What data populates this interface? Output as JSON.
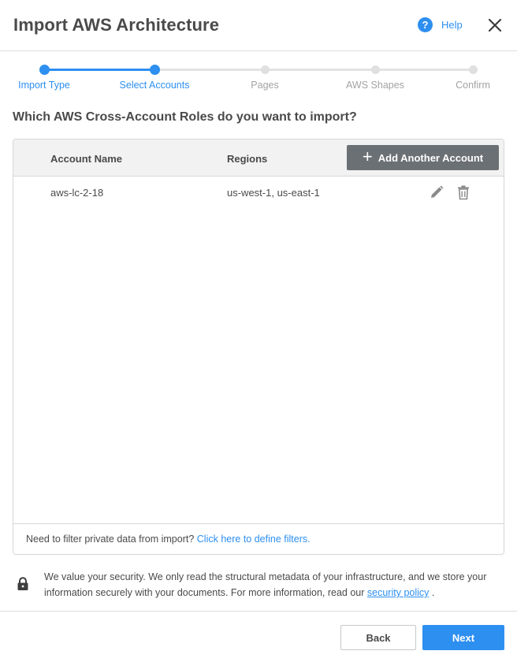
{
  "header": {
    "title": "Import AWS Architecture",
    "help_label": "Help",
    "help_icon": "question-circle-icon",
    "close_icon": "close-icon"
  },
  "stepper": {
    "steps": [
      {
        "label": "Import Type",
        "state": "complete"
      },
      {
        "label": "Select Accounts",
        "state": "current"
      },
      {
        "label": "Pages",
        "state": "pending"
      },
      {
        "label": "AWS Shapes",
        "state": "pending"
      },
      {
        "label": "Confirm",
        "state": "pending"
      }
    ]
  },
  "question": "Which AWS Cross-Account Roles do you want to import?",
  "table": {
    "columns": [
      "Account Name",
      "Regions"
    ],
    "add_button_label": "Add Another Account",
    "rows": [
      {
        "account_name": "aws-lc-2-18",
        "regions": "us-west-1, us-east-1"
      }
    ]
  },
  "filter": {
    "text": "Need to filter private data from import?",
    "link_text": "Click here to define filters."
  },
  "security": {
    "text": "We value your security. We only read the structural metadata of your infrastructure, and we store your information securely with your documents. For more information, read our",
    "link_text": "security policy",
    "suffix": "."
  },
  "footer": {
    "back_label": "Back",
    "next_label": "Next"
  },
  "colors": {
    "accent": "#2d8ff0",
    "add_button": "#6b7075",
    "pending_step": "#e0e0e0"
  }
}
